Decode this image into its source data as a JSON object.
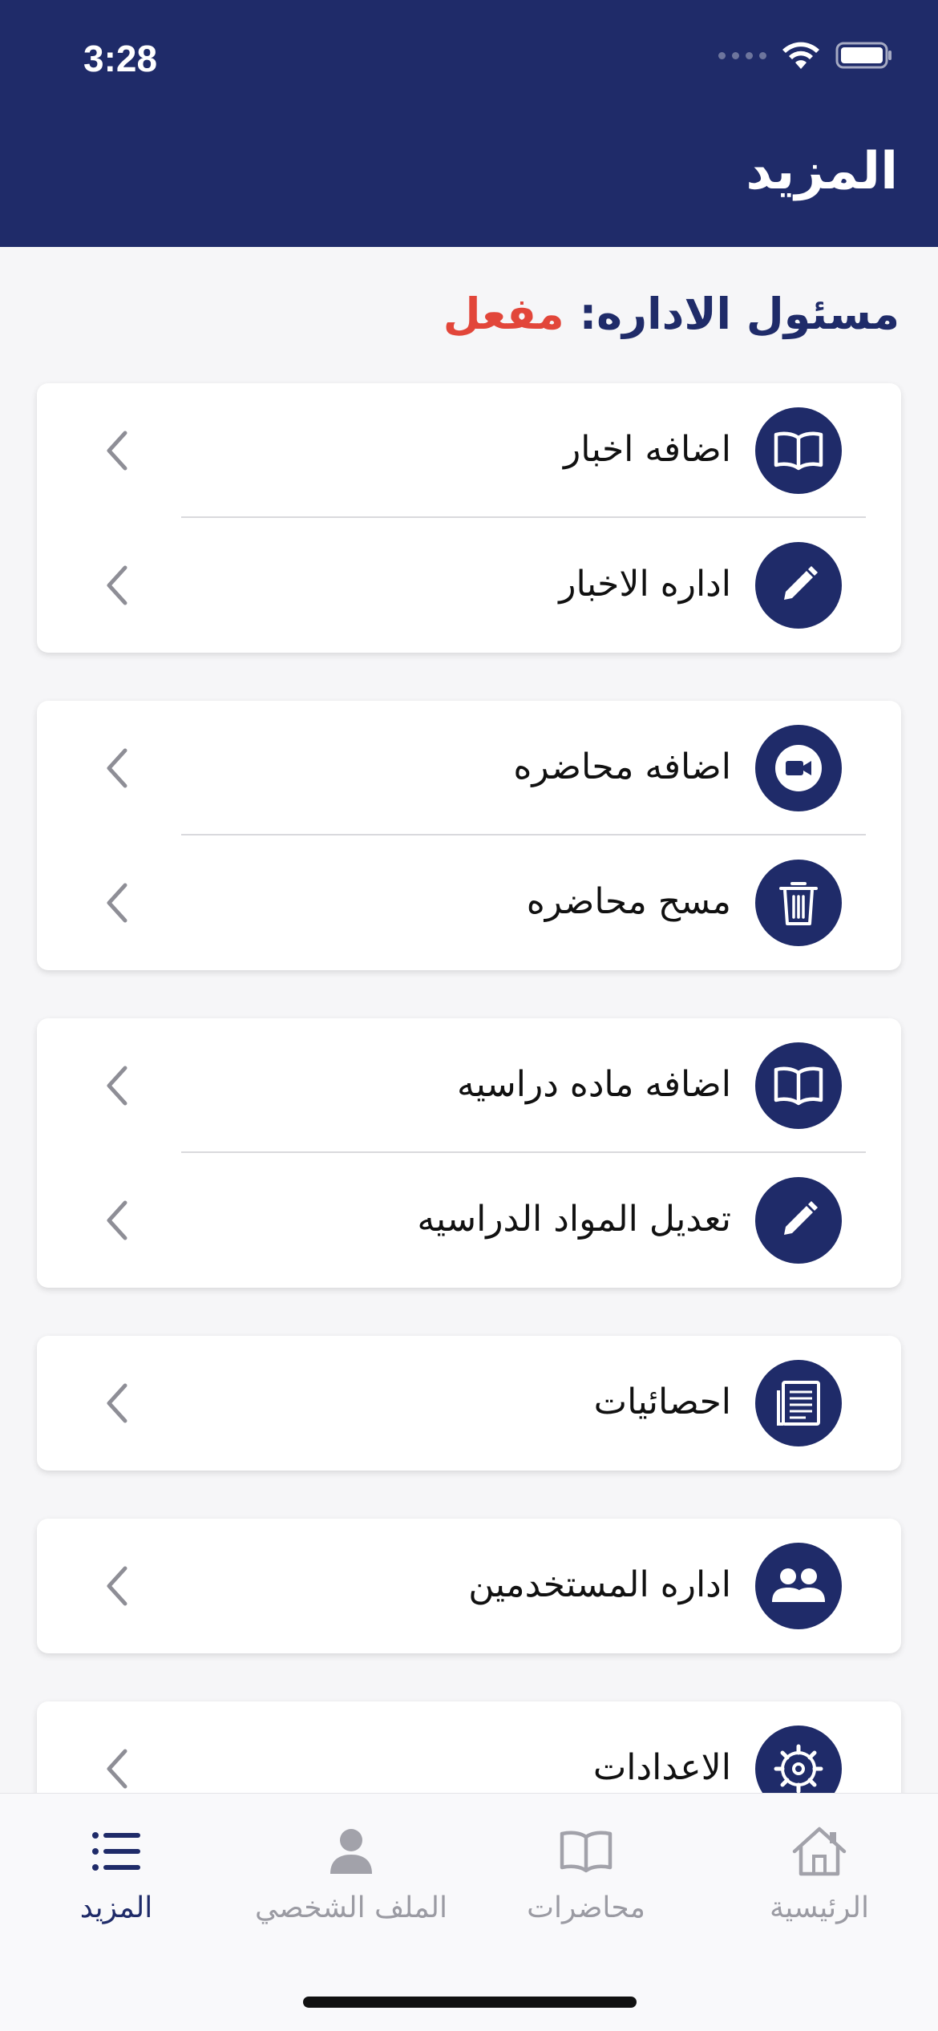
{
  "status_bar": {
    "time": "3:28"
  },
  "header": {
    "title": "المزيد"
  },
  "admin": {
    "label": "مسئول الاداره:",
    "status": "مفعل"
  },
  "groups": [
    {
      "items": [
        {
          "icon": "book-icon",
          "label": "اضافه اخبار"
        },
        {
          "icon": "pencil-icon",
          "label": "اداره الاخبار"
        }
      ]
    },
    {
      "items": [
        {
          "icon": "video-camera-icon",
          "label": "اضافه محاضره"
        },
        {
          "icon": "trash-icon",
          "label": "مسح محاضره"
        }
      ]
    },
    {
      "items": [
        {
          "icon": "book-icon",
          "label": "اضافه ماده دراسيه"
        },
        {
          "icon": "pencil-icon",
          "label": "تعديل المواد الدراسيه"
        }
      ]
    },
    {
      "items": [
        {
          "icon": "document-icon",
          "label": "احصائيات"
        }
      ]
    },
    {
      "items": [
        {
          "icon": "users-icon",
          "label": "اداره المستخدمين"
        }
      ]
    },
    {
      "items": [
        {
          "icon": "settings-gear-icon",
          "label": "الاعدادات"
        }
      ]
    }
  ],
  "tab_bar": {
    "tabs": [
      {
        "icon": "list-icon",
        "label": "المزيد",
        "active": true
      },
      {
        "icon": "person-icon",
        "label": "الملف الشخصي",
        "active": false
      },
      {
        "icon": "book-outline-icon",
        "label": "محاضرات",
        "active": false
      },
      {
        "icon": "house-icon",
        "label": "الرئيسية",
        "active": false
      }
    ]
  },
  "colors": {
    "primary": "#1f2b69",
    "status_active": "#e2463a",
    "background": "#f6f6f8",
    "inactive_tab": "#9b9ba3"
  }
}
